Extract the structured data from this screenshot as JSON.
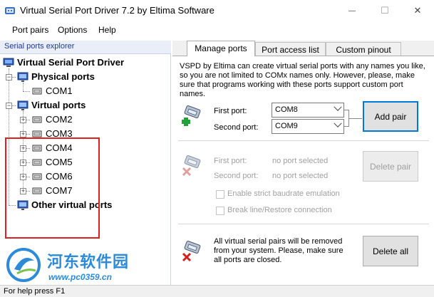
{
  "window": {
    "title": "Virtual Serial Port Driver 7.2 by Eltima Software",
    "minimize_glyph": "—",
    "maximize_glyph": "☐",
    "close_glyph": "✕"
  },
  "menu": {
    "items": [
      {
        "label": "Port pairs"
      },
      {
        "label": "Options"
      },
      {
        "label": "Help"
      }
    ]
  },
  "left_pane": {
    "header": "Serial ports explorer",
    "root": "Virtual Serial Port Driver",
    "physical_ports": "Physical ports",
    "physical_items": [
      "COM1"
    ],
    "virtual_ports": "Virtual ports",
    "virtual_items": [
      "COM2",
      "COM3",
      "COM4",
      "COM5",
      "COM6",
      "COM7"
    ],
    "other_virtual_ports": "Other virtual ports"
  },
  "tabs": [
    {
      "label": "Manage ports",
      "active": true
    },
    {
      "label": "Port access list",
      "active": false
    },
    {
      "label": "Custom pinout",
      "active": false
    }
  ],
  "manage": {
    "description": "VSPD by Eltima can create virtual serial ports with any names you like, so you are not limited to COMx names only. However, please, make sure that programs working with these ports support custom port names.",
    "first_port_label": "First port:",
    "first_port_value": "COM8",
    "second_port_label": "Second port:",
    "second_port_value": "COM9",
    "add_pair_label": "Add pair"
  },
  "delete_section": {
    "first_port_label": "First port:",
    "first_port_value": "no port selected",
    "second_port_label": "Second port:",
    "second_port_value": "no port selected",
    "delete_pair_label": "Delete pair",
    "strict_baudrate_label": "Enable strict baudrate emulation",
    "break_line_label": "Break line/Restore connection"
  },
  "delete_all_section": {
    "description": "All virtual serial pairs will be removed from your system. Please, make sure all ports are closed.",
    "delete_all_label": "Delete all"
  },
  "status": {
    "text": "For help press F1"
  },
  "watermark": {
    "text": "河东软件园",
    "url": "www.pc0359.cn"
  },
  "colors": {
    "accent": "#0078d7",
    "highlight_box": "#e02020",
    "explorer_header": "#1f3a8a",
    "watermark": "#2c8ad8"
  }
}
